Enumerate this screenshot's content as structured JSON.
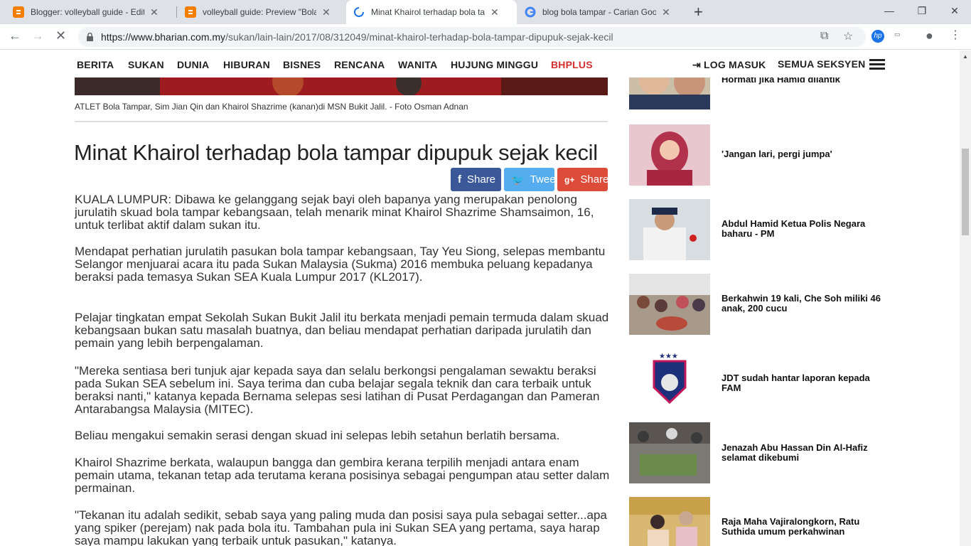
{
  "browser": {
    "tabs": [
      {
        "title": "Blogger: volleyball guide - Edit p",
        "icon": "blogger-icon",
        "color": "#f57d00"
      },
      {
        "title": "volleyball guide: Preview \"Bola Ta",
        "icon": "blogger-icon",
        "color": "#f57d00"
      },
      {
        "title": "Minat Khairol terhadap bola tamp",
        "icon": "loading-icon",
        "color": "#1a73e8"
      },
      {
        "title": "blog bola tampar - Carian Googl",
        "icon": "google-icon",
        "color": "#4285f4"
      }
    ],
    "url_domain": "https://www.bharian.com.my",
    "url_path": "/sukan/lain-lain/2017/08/312049/minat-khairol-terhadap-bola-tampar-dipupuk-sejak-kecil"
  },
  "site_nav": {
    "items": [
      "BERITA",
      "SUKAN",
      "DUNIA",
      "HIBURAN",
      "BISNES",
      "RENCANA",
      "WANITA",
      "HUJUNG MINGGU",
      "BHPLUS"
    ],
    "login": "LOG MASUK",
    "sections": "SEMUA SEKSYEN"
  },
  "article": {
    "caption": "ATLET Bola Tampar, Sim Jian Qin dan Khairol Shazrime (kanan)di MSN Bukit Jalil. - Foto Osman Adnan",
    "headline": "Minat Khairol terhadap bola tampar dipupuk sejak kecil",
    "share": {
      "facebook": "Share",
      "twitter": "Tweet",
      "google": "Share"
    },
    "paragraphs": [
      "KUALA LUMPUR: Dibawa ke gelanggang sejak bayi oleh bapanya yang merupakan penolong jurulatih skuad bola tampar kebangsaan, telah menarik minat Khairol Shazrime Shamsaimon, 16, untuk terlibat aktif dalam sukan itu.",
      "Mendapat perhatian jurulatih pasukan bola tampar kebangsaan, Tay Yeu Siong, selepas membantu Selangor menjuarai acara itu pada Sukan Malaysia (Sukma) 2016 membuka peluang kepadanya beraksi pada temasya Sukan SEA Kuala Lumpur 2017 (KL2017).",
      "Pelajar tingkatan empat Sekolah Sukan Bukit Jalil itu berkata menjadi pemain termuda dalam skuad kebangsaan bukan satu masalah buatnya, dan beliau mendapat perhatian daripada jurulatih dan pemain yang lebih berpengalaman.",
      "\"Mereka sentiasa beri tunjuk ajar kepada saya dan selalu berkongsi pengalaman sewaktu beraksi pada Sukan SEA sebelum ini. Saya terima dan cuba belajar segala teknik dan cara terbaik untuk beraksi nanti,\" katanya kepada Bernama selepas sesi latihan di Pusat Perdagangan dan Pameran Antarabangsa Malaysia (MITEC).",
      "Beliau mengakui semakin serasi dengan skuad ini selepas lebih setahun berlatih bersama.",
      "Khairol Shazrime berkata, walaupun bangga dan gembira kerana terpilih menjadi antara enam pemain utama, tekanan tetap ada terutama kerana posisinya sebagai pengumpan atau setter dalam permainan.",
      "\"Tekanan itu adalah sedikit, sebab saya yang paling muda dan posisi saya pula sebagai setter...apa yang spiker (perejam) nak pada bola itu. Tambahan pula ini Sukan SEA yang pertama, saya harap saya mampu lakukan yang terbaik untuk pasukan,\" katanya."
    ]
  },
  "sidebar": [
    {
      "title": "Hormati jika Hamid dilantik"
    },
    {
      "title": "'Jangan lari, pergi jumpa'"
    },
    {
      "title": "Abdul Hamid Ketua Polis Negara baharu - PM"
    },
    {
      "title": "Berkahwin 19 kali, Che Soh miliki 46 anak, 200 cucu"
    },
    {
      "title": "JDT sudah hantar laporan kepada FAM"
    },
    {
      "title": "Jenazah Abu Hassan Din Al-Hafiz selamat dikebumi"
    },
    {
      "title": "Raja Maha Vajiralongkorn, Ratu Suthida umum perkahwinan"
    }
  ]
}
